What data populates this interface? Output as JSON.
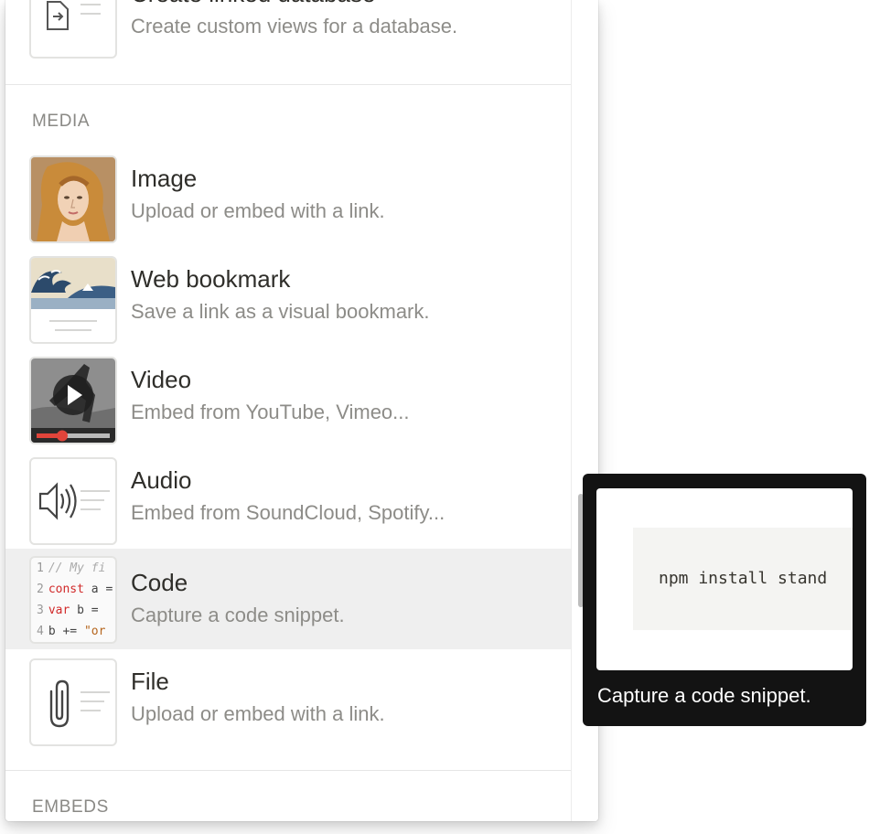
{
  "menu": {
    "items_top": [
      {
        "title": "Create linked database",
        "desc": "Create custom views for a database.",
        "icon": "linked-database-icon"
      }
    ],
    "sections": [
      {
        "label": "MEDIA",
        "items": [
          {
            "title": "Image",
            "desc": "Upload or embed with a link.",
            "icon": "venus-portrait-thumbnail"
          },
          {
            "title": "Web bookmark",
            "desc": "Save a link as a visual bookmark.",
            "icon": "great-wave-bookmark-thumbnail"
          },
          {
            "title": "Video",
            "desc": "Embed from YouTube, Vimeo...",
            "icon": "video-play-thumbnail"
          },
          {
            "title": "Audio",
            "desc": "Embed from SoundCloud, Spotify...",
            "icon": "speaker-icon"
          },
          {
            "title": "Code",
            "desc": "Capture a code snippet.",
            "icon": "code-snippet-thumbnail"
          },
          {
            "title": "File",
            "desc": "Upload or embed with a link.",
            "icon": "paperclip-icon"
          }
        ]
      },
      {
        "label": "EMBEDS",
        "items": []
      }
    ],
    "active_item": "Code"
  },
  "code_thumb": {
    "lines": [
      {
        "n": "1",
        "text": "// My fi"
      },
      {
        "n": "2",
        "kw": "const",
        "text": " a ="
      },
      {
        "n": "3",
        "kw": "var",
        "text": " b ="
      },
      {
        "n": "4",
        "text": "b += ",
        "str": "\"or"
      }
    ]
  },
  "tooltip": {
    "preview_code": "npm install stand",
    "caption": "Capture a code snippet."
  },
  "colors": {
    "active_row": "#efefef",
    "tooltip_bg": "#131313",
    "muted_text": "#8d8c88",
    "keyword": "#d12a2a",
    "video_progress": "#e0443a"
  }
}
